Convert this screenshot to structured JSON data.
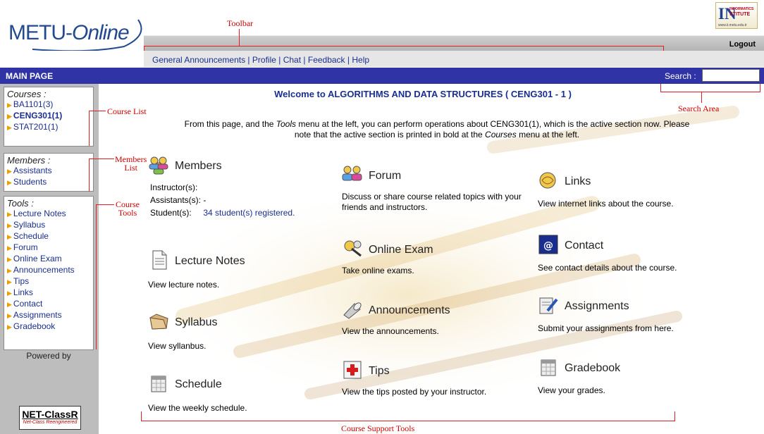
{
  "header": {
    "logo": {
      "main": "METU-",
      "italic": "Online"
    },
    "institute_logo": {
      "big": "IN",
      "small_top": "INFORMATICS",
      "small_bottom": "STITUTE",
      "url": "www.ii.metu.edu.tr"
    },
    "logout": "Logout",
    "toolbar_links": [
      "General Announcements",
      "Profile",
      "Chat",
      "Feedback",
      "Help"
    ]
  },
  "bluebar": {
    "title": "MAIN PAGE",
    "search_label": "Search :",
    "search_value": ""
  },
  "sidebar": {
    "courses": {
      "heading": "Courses :",
      "items": [
        "BA1101(3)",
        "CENG301(1)",
        "STAT201(1)"
      ]
    },
    "members": {
      "heading": "Members :",
      "items": [
        "Assistants",
        "Students"
      ]
    },
    "tools": {
      "heading": "Tools :",
      "items": [
        "Lecture Notes",
        "Syllabus",
        "Schedule",
        "Forum",
        "Online Exam",
        "Announcements",
        "Tips",
        "Links",
        "Contact",
        "Assignments",
        "Gradebook"
      ]
    },
    "powered_by": "Powered by",
    "netclassr": {
      "title": "NET-ClassR",
      "subtitle": "Net-Class Reengineered"
    }
  },
  "main": {
    "welcome": "Welcome to ALGORITHMS AND DATA STRUCTURES ( CENG301 - 1 )",
    "intro": {
      "p1": "From this page, and the ",
      "tools_word": "Tools",
      "p2": " menu at the left, you can perform operations about CENG301(1), which is the active section now. Please note that the active section is printed in bold at the ",
      "courses_word": "Courses",
      "p3": " menu at the left."
    },
    "members": {
      "title": "Members",
      "instructor_label": "Instructor(s):",
      "instructor_value": "",
      "assistants_label": "Assistants(s): -",
      "students_label": "Student(s):",
      "students_value": "34 student(s) registered."
    },
    "tools": {
      "lecture_notes": {
        "title": "Lecture Notes",
        "desc": "View lecture notes."
      },
      "syllabus": {
        "title": "Syllabus",
        "desc": "View syllanbus."
      },
      "schedule": {
        "title": "Schedule",
        "desc": "View the weekly schedule."
      },
      "forum": {
        "title": "Forum",
        "desc": "Discuss or share course related topics with your friends and instructors."
      },
      "online_exam": {
        "title": "Online Exam",
        "desc": "Take online exams."
      },
      "announcements": {
        "title": "Announcements",
        "desc": "View the announcements."
      },
      "tips": {
        "title": "Tips",
        "desc": "View the tips posted by your instructor."
      },
      "links": {
        "title": "Links",
        "desc": "View internet links about the course."
      },
      "contact": {
        "title": "Contact",
        "desc": "See contact details about the course."
      },
      "assignments": {
        "title": "Assignments",
        "desc": "Submit your assignments from here."
      },
      "gradebook": {
        "title": "Gradebook",
        "desc": "View your grades."
      }
    }
  },
  "annotations": {
    "toolbar": "Toolbar",
    "course_list": "Course List",
    "members_list_1": "Members",
    "members_list_2": "List",
    "course_tools_1": "Course",
    "course_tools_2": "Tools",
    "search_area": "Search Area",
    "course_support_tools": "Course Support Tools"
  },
  "colors": {
    "bluebar": "#2f33a6",
    "link": "#1a2e8f",
    "annotation": "#cc0000",
    "sidebar": "#bdbdbd"
  }
}
